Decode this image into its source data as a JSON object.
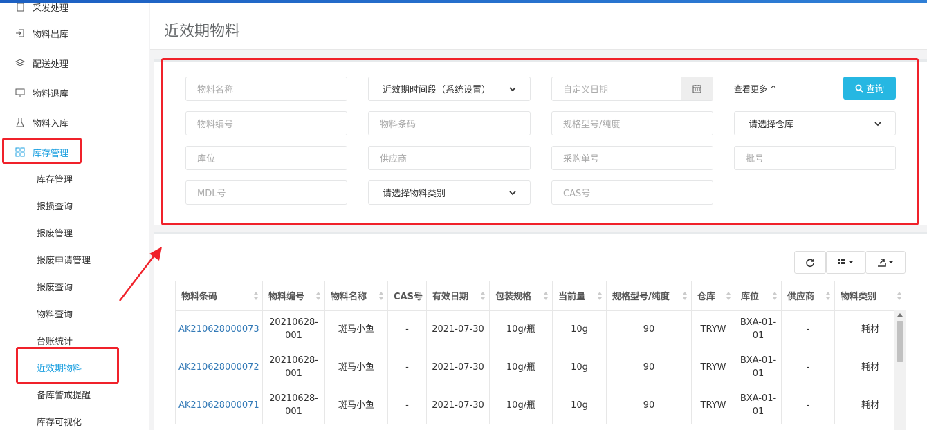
{
  "sidebar": {
    "top_partial": "采发处理",
    "items": [
      {
        "label": "物料出库",
        "icon": "exit-icon"
      },
      {
        "label": "配送处理",
        "icon": "layers-icon"
      },
      {
        "label": "物料退库",
        "icon": "monitor-icon"
      },
      {
        "label": "物料入库",
        "icon": "flask-icon"
      },
      {
        "label": "库存管理",
        "icon": "grid-icon"
      }
    ],
    "sub_items": [
      "库存管理",
      "报损查询",
      "报废管理",
      "报废申请管理",
      "报废查询",
      "物料查询",
      "台账统计",
      "近效期物料",
      "备库警戒提醒",
      "库存可视化"
    ]
  },
  "page": {
    "title": "近效期物料"
  },
  "search": {
    "material_name_placeholder": "物料名称",
    "period_select": "近效期时间段（系统设置）",
    "custom_date_placeholder": "自定义日期",
    "more_label": "查看更多",
    "query_label": "查询",
    "material_code_placeholder": "物料编号",
    "barcode_placeholder": "物料条码",
    "spec_placeholder": "规格型号/纯度",
    "warehouse_select": "请选择仓库",
    "location_placeholder": "库位",
    "supplier_placeholder": "供应商",
    "purchase_no_placeholder": "采购单号",
    "batch_placeholder": "批号",
    "mdl_placeholder": "MDL号",
    "category_select": "请选择物料类别",
    "cas_placeholder": "CAS号"
  },
  "table": {
    "columns": [
      "物料条码",
      "物料编号",
      "物料名称",
      "CAS号",
      "有效日期",
      "包装规格",
      "当前量",
      "规格型号/纯度",
      "仓库",
      "库位",
      "供应商",
      "物料类别"
    ],
    "rows": [
      [
        "AK210628000073",
        "20210628-001",
        "斑马小鱼",
        "-",
        "2021-07-30",
        "10g/瓶",
        "10g",
        "90",
        "TRYW",
        "BXA-01-01",
        "-",
        "耗材"
      ],
      [
        "AK210628000072",
        "20210628-001",
        "斑马小鱼",
        "-",
        "2021-07-30",
        "10g/瓶",
        "10g",
        "90",
        "TRYW",
        "BXA-01-01",
        "-",
        "耗材"
      ],
      [
        "AK210628000071",
        "20210628-001",
        "斑马小鱼",
        "-",
        "2021-07-30",
        "10g/瓶",
        "10g",
        "90",
        "TRYW",
        "BXA-01-01",
        "-",
        "耗材"
      ]
    ]
  },
  "colors": {
    "accent": "#1a9fe0",
    "highlight": "#f0212a",
    "query_button": "#26b7e2",
    "link": "#337ab7"
  }
}
